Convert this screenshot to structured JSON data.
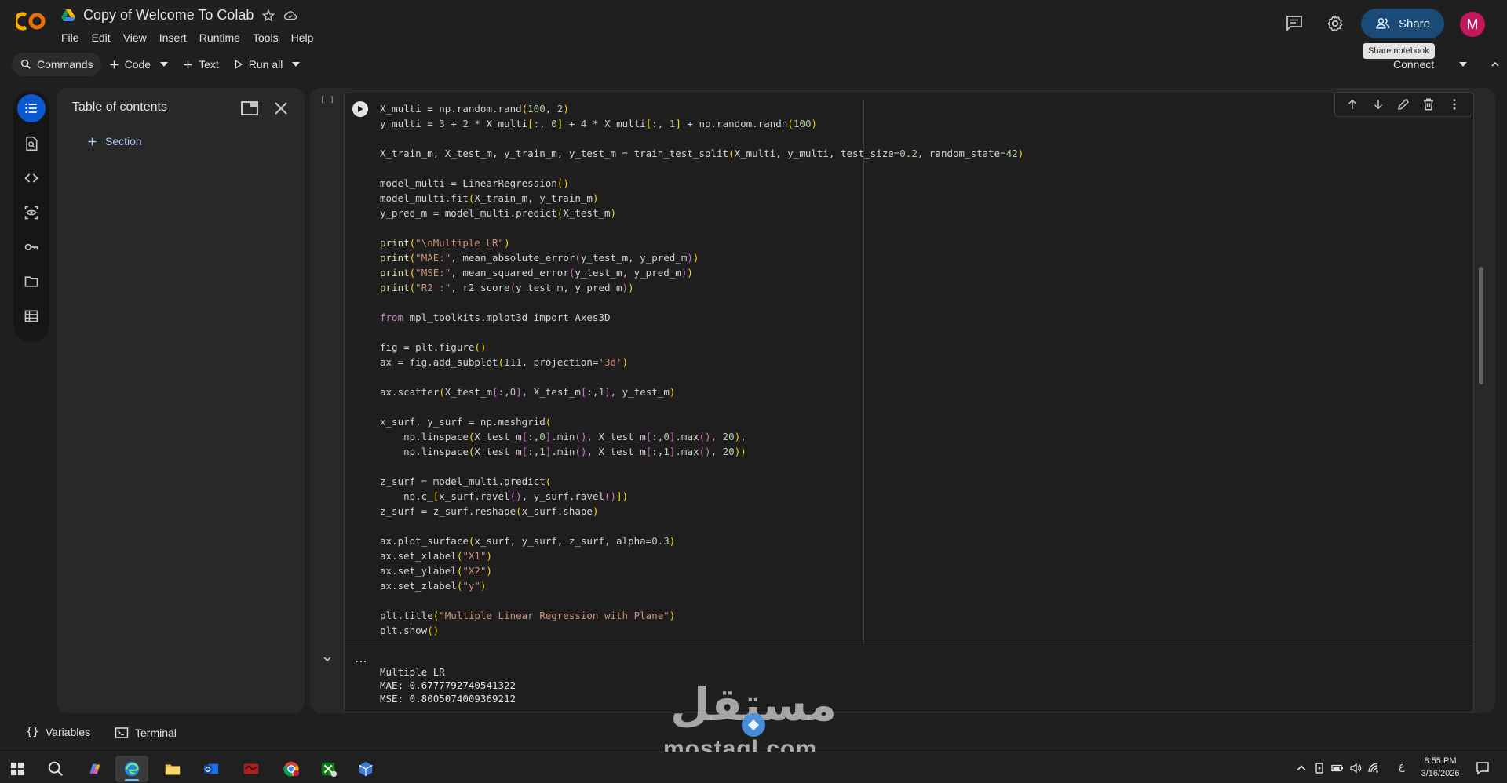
{
  "app": {
    "title": "Copy of Welcome To Colab",
    "menu": [
      "File",
      "Edit",
      "View",
      "Insert",
      "Runtime",
      "Tools",
      "Help"
    ],
    "share_label": "Share",
    "share_tooltip": "Share notebook",
    "avatar_letter": "M"
  },
  "toolbar": {
    "commands_label": "Commands",
    "code_label": "Code",
    "text_label": "Text",
    "run_all_label": "Run all",
    "connect_label": "Connect"
  },
  "sidebar": {
    "toc_title": "Table of contents",
    "section_label": "Section",
    "rail_icons": [
      "toc-list-icon",
      "find-icon",
      "code-snippets-icon",
      "inspect-icon",
      "secrets-key-icon",
      "files-folder-icon",
      "data-table-icon"
    ]
  },
  "cell": {
    "bracket": "[ ]",
    "code_lines": [
      "X_multi = np.random.rand(100, 2)",
      "y_multi = 3 + 2 * X_multi[:, 0] + 4 * X_multi[:, 1] + np.random.randn(100)",
      "",
      "X_train_m, X_test_m, y_train_m, y_test_m = train_test_split(X_multi, y_multi, test_size=0.2, random_state=42)",
      "",
      "model_multi = LinearRegression()",
      "model_multi.fit(X_train_m, y_train_m)",
      "y_pred_m = model_multi.predict(X_test_m)",
      "",
      "print(\"\\nMultiple LR\")",
      "print(\"MAE:\", mean_absolute_error(y_test_m, y_pred_m))",
      "print(\"MSE:\", mean_squared_error(y_test_m, y_pred_m))",
      "print(\"R2 :\", r2_score(y_test_m, y_pred_m))",
      "",
      "from mpl_toolkits.mplot3d import Axes3D",
      "",
      "fig = plt.figure()",
      "ax = fig.add_subplot(111, projection='3d')",
      "",
      "ax.scatter(X_test_m[:,0], X_test_m[:,1], y_test_m)",
      "",
      "x_surf, y_surf = np.meshgrid(",
      "    np.linspace(X_test_m[:,0].min(), X_test_m[:,0].max(), 20),",
      "    np.linspace(X_test_m[:,1].min(), X_test_m[:,1].max(), 20))",
      "",
      "z_surf = model_multi.predict(",
      "    np.c_[x_surf.ravel(), y_surf.ravel()])",
      "z_surf = z_surf.reshape(x_surf.shape)",
      "",
      "ax.plot_surface(x_surf, y_surf, z_surf, alpha=0.3)",
      "ax.set_xlabel(\"X1\")",
      "ax.set_ylabel(\"X2\")",
      "ax.set_zlabel(\"y\")",
      "",
      "plt.title(\"Multiple Linear Regression with Plane\")",
      "plt.show()"
    ],
    "output_lines": [
      "Multiple LR",
      "MAE: 0.6777792740541322",
      "MSE: 0.8005074009369212"
    ]
  },
  "bottombar": {
    "variables_label": "Variables",
    "terminal_label": "Terminal"
  },
  "watermark": {
    "arabic": "مستقل",
    "latin": "mostaql.com"
  },
  "taskbar": {
    "apps": [
      "windows-start-icon",
      "search-icon",
      "copilot-icon",
      "edge-browser-icon",
      "file-explorer-icon",
      "outlook-icon",
      "app-red-icon",
      "chrome-icon",
      "xbox-icon",
      "app-cube-icon"
    ],
    "time": "8:55 PM",
    "date": "3/16/2026",
    "lang": "ع"
  },
  "colors": {
    "accent": "#0b57d0",
    "share_bg": "#194b76",
    "avatar": "#c2185b"
  }
}
